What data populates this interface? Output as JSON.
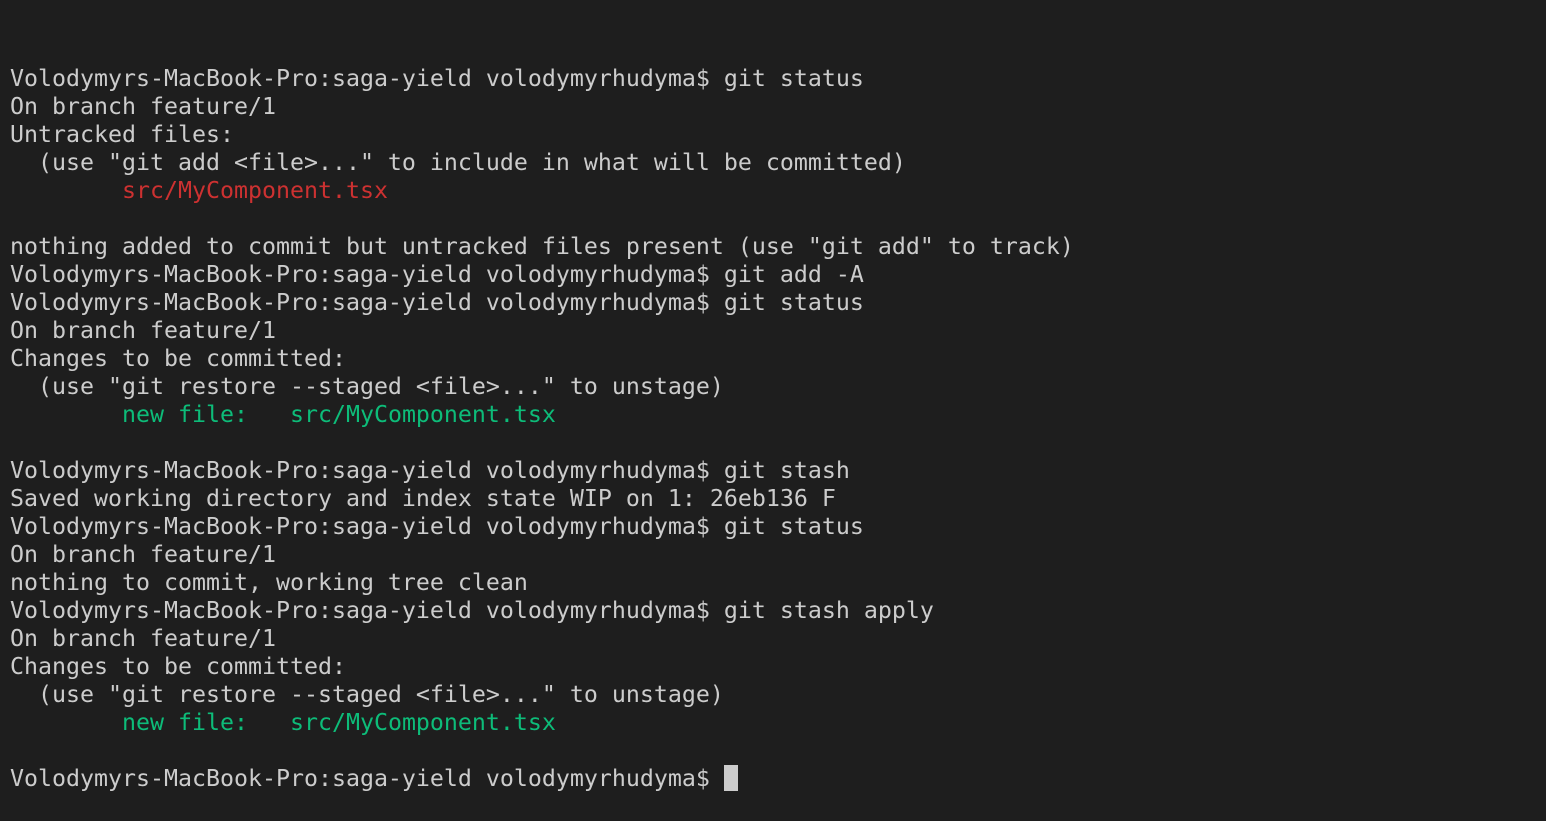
{
  "terminal": {
    "colors": {
      "background": "#1e1e1e",
      "text": "#cccccc",
      "untracked": "#cd3131",
      "staged": "#0dbc79"
    },
    "lines": [
      [
        {
          "t": "Volodymyrs-MacBook-Pro:saga-yield volodymyrhudyma$ git status"
        }
      ],
      [
        {
          "t": "On branch feature/1"
        }
      ],
      [
        {
          "t": "Untracked files:"
        }
      ],
      [
        {
          "t": "  (use \"git add <file>...\" to include in what will be committed)"
        }
      ],
      [
        {
          "t": "        "
        },
        {
          "t": "src/MyComponent.tsx",
          "c": "red"
        }
      ],
      [
        {
          "t": ""
        }
      ],
      [
        {
          "t": "nothing added to commit but untracked files present (use \"git add\" to track)"
        }
      ],
      [
        {
          "t": "Volodymyrs-MacBook-Pro:saga-yield volodymyrhudyma$ git add -A"
        }
      ],
      [
        {
          "t": "Volodymyrs-MacBook-Pro:saga-yield volodymyrhudyma$ git status"
        }
      ],
      [
        {
          "t": "On branch feature/1"
        }
      ],
      [
        {
          "t": "Changes to be committed:"
        }
      ],
      [
        {
          "t": "  (use \"git restore --staged <file>...\" to unstage)"
        }
      ],
      [
        {
          "t": "        "
        },
        {
          "t": "new file:   src/MyComponent.tsx",
          "c": "green"
        }
      ],
      [
        {
          "t": ""
        }
      ],
      [
        {
          "t": "Volodymyrs-MacBook-Pro:saga-yield volodymyrhudyma$ git stash"
        }
      ],
      [
        {
          "t": "Saved working directory and index state WIP on 1: 26eb136 F"
        }
      ],
      [
        {
          "t": "Volodymyrs-MacBook-Pro:saga-yield volodymyrhudyma$ git status"
        }
      ],
      [
        {
          "t": "On branch feature/1"
        }
      ],
      [
        {
          "t": "nothing to commit, working tree clean"
        }
      ],
      [
        {
          "t": "Volodymyrs-MacBook-Pro:saga-yield volodymyrhudyma$ git stash apply"
        }
      ],
      [
        {
          "t": "On branch feature/1"
        }
      ],
      [
        {
          "t": "Changes to be committed:"
        }
      ],
      [
        {
          "t": "  (use \"git restore --staged <file>...\" to unstage)"
        }
      ],
      [
        {
          "t": "        "
        },
        {
          "t": "new file:   src/MyComponent.tsx",
          "c": "green"
        }
      ],
      [
        {
          "t": ""
        }
      ]
    ],
    "prompt": "Volodymyrs-MacBook-Pro:saga-yield volodymyrhudyma$ "
  }
}
